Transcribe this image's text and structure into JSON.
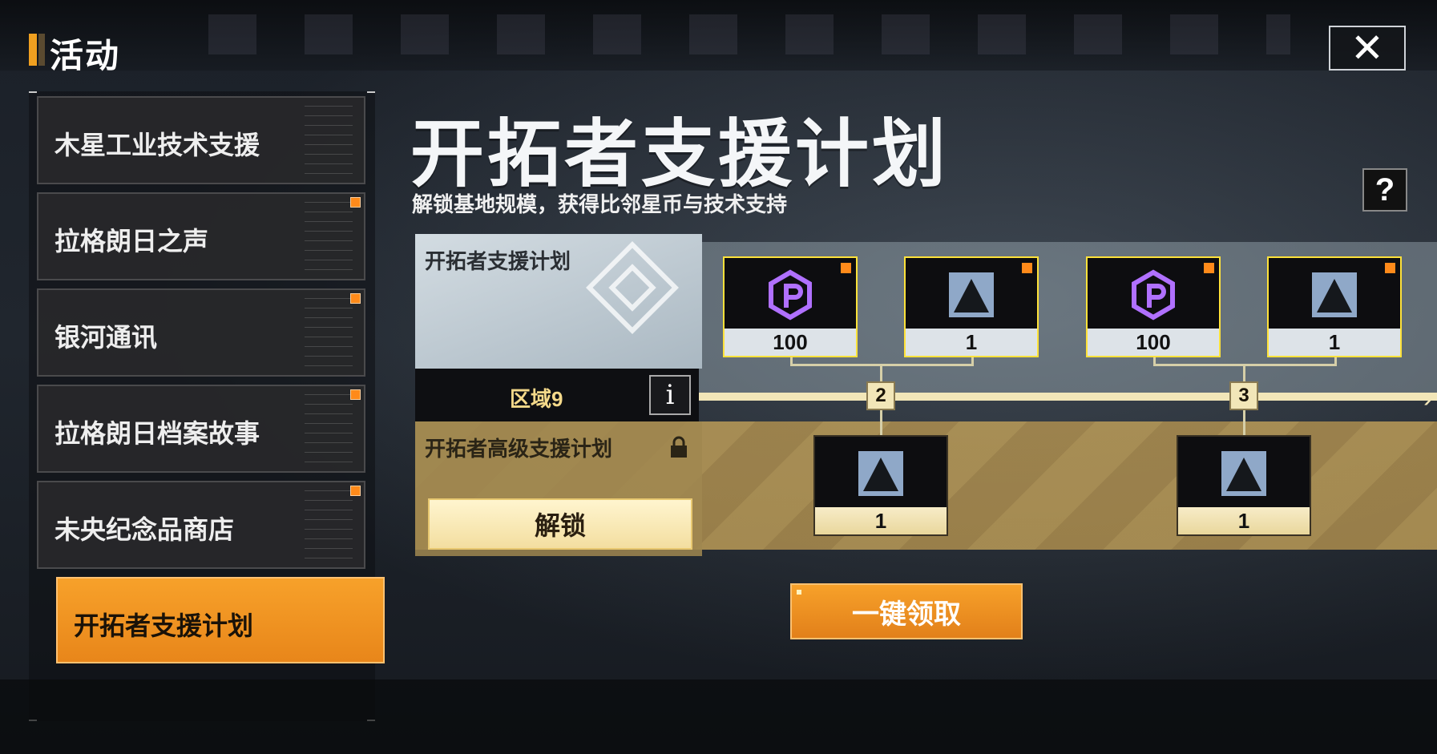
{
  "header": {
    "title": "活动",
    "close_icon": "close-icon"
  },
  "sidebar": {
    "items": [
      {
        "label": "木星工业技术支援",
        "badge": false
      },
      {
        "label": "拉格朗日之声",
        "badge": true
      },
      {
        "label": "银河通讯",
        "badge": true
      },
      {
        "label": "拉格朗日档案故事",
        "badge": true
      },
      {
        "label": "未央纪念品商店",
        "badge": true
      },
      {
        "label": "开拓者支援计划",
        "badge": false,
        "active": true
      }
    ]
  },
  "main": {
    "title": "开拓者支援计划",
    "subtitle": "解锁基地规模，获得比邻星币与技术支持",
    "help_icon": "question-icon",
    "free_tier_label": "开拓者支援计划",
    "zone_label": "区域9",
    "info_icon": "info-icon",
    "premium_tier_label": "开拓者高级支援计划",
    "lock_icon": "lock-icon",
    "unlock_label": "解锁",
    "claim_all_label": "一键领取"
  },
  "rewards": {
    "free": [
      {
        "icon": "proxima-coin-icon",
        "count": "100",
        "badge": true
      },
      {
        "icon": "tech-pyramid-icon",
        "count": "1",
        "badge": true
      },
      {
        "icon": "proxima-coin-icon",
        "count": "100",
        "badge": true
      },
      {
        "icon": "tech-pyramid-icon",
        "count": "1",
        "badge": true
      }
    ],
    "premium": [
      {
        "icon": "tech-pyramid-icon",
        "count": "1"
      },
      {
        "icon": "tech-pyramid-icon",
        "count": "1"
      }
    ],
    "nodes": [
      "2",
      "3"
    ]
  },
  "colors": {
    "accent": "#f7a12a",
    "reward_border": "#ffe23a",
    "badge": "#ff8a1a",
    "coin_purple": "#b070ff"
  },
  "glyphs": {
    "close": "✕",
    "help": "?",
    "info": "i",
    "arrow": "›"
  }
}
